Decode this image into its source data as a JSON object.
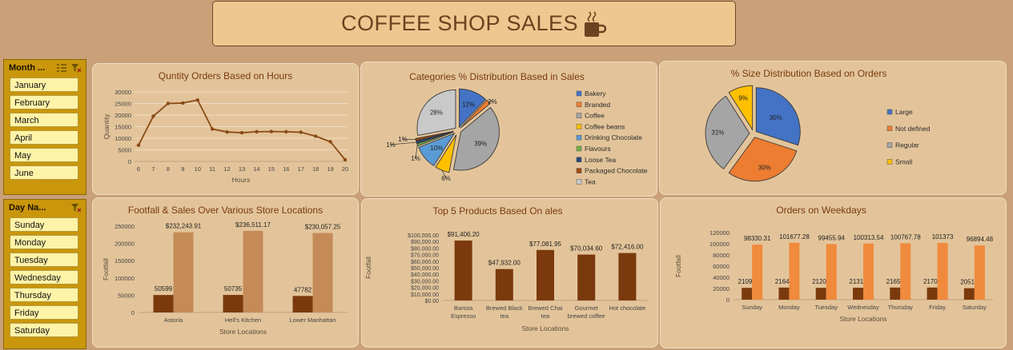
{
  "dashboard": {
    "title": "COFFEE SHOP SALES"
  },
  "slicers": {
    "month": {
      "title": "Month ...",
      "items": [
        "January",
        "February",
        "March",
        "April",
        "May",
        "June"
      ]
    },
    "day": {
      "title": "Day Na...",
      "items": [
        "Sunday",
        "Monday",
        "Tuesday",
        "Wednesday",
        "Thursday",
        "Friday",
        "Saturday"
      ]
    }
  },
  "chart_data": [
    {
      "id": "hours",
      "type": "line",
      "title": "Quntity Orders Based on Hours",
      "xlabel": "Hours",
      "ylabel": "Quantity",
      "x": [
        "6",
        "7",
        "8",
        "9",
        "10",
        "11",
        "12",
        "13",
        "14",
        "15",
        "16",
        "17",
        "18",
        "19",
        "20"
      ],
      "values": [
        7000,
        19500,
        25000,
        25200,
        26500,
        14000,
        12700,
        12400,
        12800,
        12900,
        12800,
        12600,
        10900,
        8500,
        700
      ],
      "ylim": [
        0,
        30000
      ],
      "yticks": [
        "0",
        "5000",
        "10000",
        "15000",
        "20000",
        "25000",
        "30000"
      ],
      "grid": true,
      "color": "#8a4a14"
    },
    {
      "id": "categories",
      "type": "pie",
      "title": "Categories % Distribution Based in Sales",
      "legend_position": "right",
      "slices": [
        {
          "name": "Bakery",
          "value": 12,
          "label": "12%",
          "color": "#4472c4"
        },
        {
          "name": "Branded",
          "value": 2,
          "label": "2%",
          "color": "#ed7d31"
        },
        {
          "name": "Coffee",
          "value": 39,
          "label": "39%",
          "color": "#a5a5a5"
        },
        {
          "name": "Coffee beans",
          "value": 6,
          "label": "6%",
          "color": "#ffc000"
        },
        {
          "name": "Drinking Chocolate",
          "value": 10,
          "label": "10%",
          "color": "#5b9bd5"
        },
        {
          "name": "Flavours",
          "value": 1,
          "label": "1%",
          "color": "#70ad47"
        },
        {
          "name": "Loose Tea",
          "value": 1,
          "label": "1%",
          "color": "#264478"
        },
        {
          "name": "Packaged Chocolate",
          "value": 1,
          "label": "1%",
          "color": "#9e480e"
        },
        {
          "name": "Tea",
          "value": 28,
          "label": "28%",
          "color": "#c9c9c9"
        }
      ]
    },
    {
      "id": "sizes",
      "type": "pie",
      "title": "% Size Distribution Based on Orders",
      "legend_position": "right",
      "slices": [
        {
          "name": "Large",
          "value": 30,
          "label": "30%",
          "color": "#4472c4"
        },
        {
          "name": "Not defined",
          "value": 30,
          "label": "30%",
          "color": "#ed7d31"
        },
        {
          "name": "Regular",
          "value": 31,
          "label": "31%",
          "color": "#a5a5a5"
        },
        {
          "name": "Small",
          "value": 9,
          "label": "9%",
          "color": "#ffc000"
        }
      ]
    },
    {
      "id": "stores",
      "type": "bar",
      "title": "Footfall & Sales Over Various Store Locations",
      "xlabel": "Store Locations",
      "ylabel": "Footfall",
      "categories": [
        "Astoria",
        "Hell's Kitchen",
        "Lower Manhattan"
      ],
      "series": [
        {
          "values": [
            50599,
            50735,
            47782
          ],
          "labels": [
            "50599",
            "50735",
            "47782"
          ],
          "color": "#7b3a0e"
        },
        {
          "values": [
            232243.91,
            236511.17,
            230057.25
          ],
          "labels": [
            "$232,243.91",
            "$236,511.17",
            "$230,057.25"
          ],
          "color": "#c48b58"
        }
      ],
      "ylim": [
        0,
        250000
      ],
      "yticks": [
        "0",
        "50000",
        "100000",
        "150000",
        "200000",
        "250000"
      ]
    },
    {
      "id": "products",
      "type": "bar",
      "title": "Top 5 Products Based On ales",
      "xlabel": "Store Locations",
      "ylabel": "Footfall",
      "categories": [
        [
          "Barista",
          "Espresso"
        ],
        [
          "Brewed Black",
          "tea"
        ],
        [
          "Brewed Chai",
          "tea"
        ],
        [
          "Gourmet",
          "brewed coffee"
        ],
        [
          "Hot chocolate"
        ]
      ],
      "series": [
        {
          "values": [
            91406.2,
            47932.0,
            77081.95,
            70034.6,
            72416.0
          ],
          "labels": [
            "$91,406.20",
            "$47,932.00",
            "$77,081.95",
            "$70,034.60",
            "$72,416.00"
          ],
          "color": "#7b3a0e"
        }
      ],
      "ylim": [
        0,
        100000
      ],
      "yticks": [
        "$0.00",
        "$10,000.00",
        "$20,000.00",
        "$30,000.00",
        "$40,000.00",
        "$50,000.00",
        "$60,000.00",
        "$70,000.00",
        "$80,000.00",
        "$90,000.00",
        "$100,000.00"
      ]
    },
    {
      "id": "weekdays",
      "type": "bar",
      "title": "Orders on Weekdays",
      "xlabel": "Store Locations",
      "ylabel": "Footfall",
      "categories": [
        "Sunday",
        "Monday",
        "Tuesday",
        "Wednesday",
        "Thursday",
        "Friday",
        "Saturday"
      ],
      "series": [
        {
          "values": [
            21096,
            21643,
            21202,
            21310,
            21654,
            21701,
            20510
          ],
          "labels": [
            "21096",
            "21643",
            "21202",
            "21310",
            "21654",
            "21701",
            "20510"
          ],
          "color": "#7b3a0e"
        },
        {
          "values": [
            98330.31,
            101677.28,
            99455.94,
            100313.54,
            100767.78,
            101373,
            96894.48
          ],
          "labels": [
            "98330.31",
            "101677.28",
            "99455.94",
            "100313.54",
            "100767.78",
            "101373",
            "96894.48"
          ],
          "color": "#f08a3c"
        }
      ],
      "ylim": [
        0,
        120000
      ],
      "yticks": [
        "0",
        "20000",
        "40000",
        "60000",
        "80000",
        "100000",
        "120000"
      ]
    }
  ]
}
